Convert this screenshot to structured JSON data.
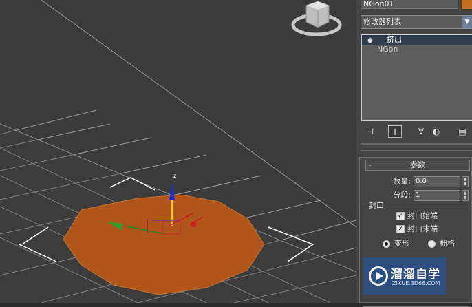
{
  "viewport": {
    "gizmo_axis_label": "z",
    "accent_object_color": "#c76b1e"
  },
  "panel": {
    "object_name": "NGon01",
    "object_color": "#c76b1e",
    "modifier_list_label": "修改器列表",
    "modifier_stack": [
      {
        "label": "挤出",
        "selected": true
      },
      {
        "label": "NGon",
        "selected": false
      }
    ],
    "toolbar_icons": [
      "pin-stack-icon",
      "show-end-result-icon",
      "make-unique-icon",
      "remove-modifier-icon",
      "configure-sets-icon"
    ],
    "rollout": {
      "collapse_symbol": "-",
      "title": "参数",
      "amount_label": "数量:",
      "amount_value": "0.0",
      "segments_label": "分段:",
      "segments_value": "1",
      "capping_group_label": "封口",
      "cap_start_label": "封口始端",
      "cap_end_label": "封口末端",
      "morph_label": "变形",
      "grid_label": "栅格",
      "cap_start_checked": true,
      "cap_end_checked": true,
      "selected_cap_type": "变形"
    }
  },
  "watermark": {
    "title": "溜溜自学",
    "subtitle": "ZIXUE.3D66.COM"
  }
}
